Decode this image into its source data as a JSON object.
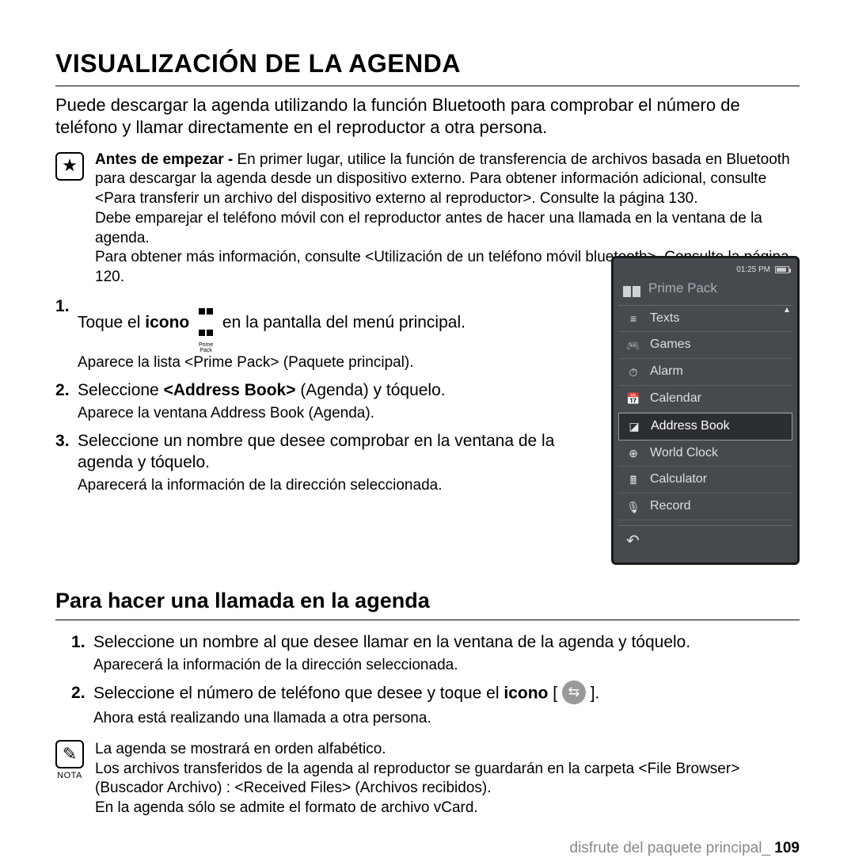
{
  "title": "VISUALIZACIÓN DE LA AGENDA",
  "intro": "Puede descargar la agenda utilizando la función Bluetooth para comprobar el número de teléfono y llamar directamente en el reproductor a otra persona.",
  "note": {
    "lead": "Antes de empezar - ",
    "text1": "En primer lugar, utilice la función de transferencia de archivos basada en Bluetooth para descargar la agenda desde un dispositivo externo. Para obtener información adicional, consulte <Para transferir un archivo del dispositivo externo al reproductor>. Consulte la página 130.",
    "text2": "Debe emparejar el teléfono móvil con el reproductor antes de hacer una llamada en la ventana de la agenda.",
    "text3": "Para obtener más información, consulte <Utilización de un teléfono móvil bluetooth>. Consulte la página 120."
  },
  "steps1": {
    "s1a": "Toque el ",
    "s1b": "icono",
    "s1c": " en la pantalla del menú principal.",
    "s1sub": "Aparece la lista <Prime Pack> (Paquete principal).",
    "s2a": "Seleccione ",
    "s2b": "<Address Book>",
    "s2c": " (Agenda) y tóquelo.",
    "s2sub": "Aparece la ventana Address Book (Agenda).",
    "s3": "Seleccione un nombre que desee comprobar en la ventana de la agenda y tóquelo.",
    "s3sub": "Aparecerá la información de la dirección seleccionada.",
    "iconLabel": "Prime Pack"
  },
  "subtitle": "Para hacer una llamada en la agenda",
  "steps2": {
    "s1": "Seleccione un nombre al que desee llamar en la ventana de la agenda y tóquelo.",
    "s1sub": "Aparecerá la información de la dirección seleccionada.",
    "s2a": "Seleccione el número de teléfono que desee y toque el ",
    "s2b": "icono",
    "s2c_open": " [ ",
    "s2c_close": " ].",
    "s2sub": "Ahora está realizando una llamada a otra persona."
  },
  "nota": {
    "label": "NOTA",
    "l1": "La agenda se mostrará en orden alfabético.",
    "l2": "Los archivos transferidos de la agenda al reproductor se guardarán en la carpeta <File Browser> (Buscador Archivo)  :  <Received Files> (Archivos recibidos).",
    "l3": "En la agenda sólo se admite el formato de archivo vCard."
  },
  "footer": {
    "text": "disfrute del paquete principal_ ",
    "page": "109"
  },
  "device": {
    "time": "01:25 PM",
    "title": "Prime Pack",
    "items": [
      {
        "icon": "≡",
        "label": "Texts"
      },
      {
        "icon": "🎮",
        "label": "Games"
      },
      {
        "icon": "⏱",
        "label": "Alarm"
      },
      {
        "icon": "📅",
        "label": "Calendar"
      },
      {
        "icon": "◪",
        "label": "Address Book"
      },
      {
        "icon": "⊕",
        "label": "World Clock"
      },
      {
        "icon": "🖩",
        "label": "Calculator"
      },
      {
        "icon": "🎙",
        "label": "Record"
      }
    ],
    "selectedIndex": 4,
    "back": "↶"
  }
}
